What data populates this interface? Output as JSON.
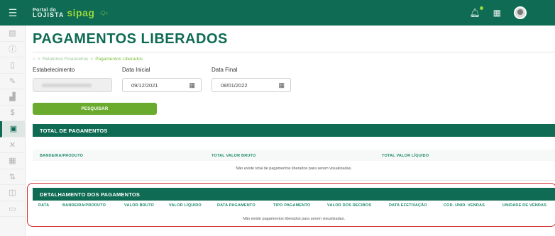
{
  "brand": {
    "portal_small": "Portal do",
    "portal_big": "LOJISTA",
    "name": "sipag",
    "tail": "-Q+"
  },
  "page": {
    "title": "PAGAMENTOS LIBERADOS"
  },
  "breadcrumb": {
    "home": "⌂",
    "sep1": ">",
    "item1": "Relatórios Financeiros",
    "sep2": ">",
    "current": "Pagamentos Liberados"
  },
  "filters": {
    "estabelecimento_label": "Estabelecimento",
    "data_inicial_label": "Data Inicial",
    "data_inicial_value": "09/12/2021",
    "data_final_label": "Data Final",
    "data_final_value": "08/01/2022"
  },
  "search_button": "PESQUISAR",
  "total_section": {
    "title": "TOTAL DE PAGAMENTOS",
    "columns": [
      "BANDEIRA/PRODUTO",
      "TOTAL VALOR BRUTO",
      "TOTAL VALOR LÍQUIDO"
    ],
    "empty_message": "Não existe total de pagamentos liberados para serem visualizadas."
  },
  "detail_section": {
    "title": "DETALHAMENTO DOS PAGAMENTOS",
    "columns": [
      "DATA",
      "BANDEIRA/PRODUTO",
      "VALOR BRUTO",
      "VALOR LÍQUIDO",
      "DATA PAGAMENTO",
      "TIPO PAGAMENTO",
      "VALOR DOS RECIBOS",
      "DATA EFETIVAÇÃO",
      "COD. UNID. VENDAS",
      "UNIDADE DE VENDAS"
    ],
    "empty_message": "Não existe pagamentos liberados para serem visualizadas."
  },
  "colors": {
    "primary": "#0f6b53",
    "accent": "#6aab2e",
    "highlight_border": "#d0272b"
  }
}
